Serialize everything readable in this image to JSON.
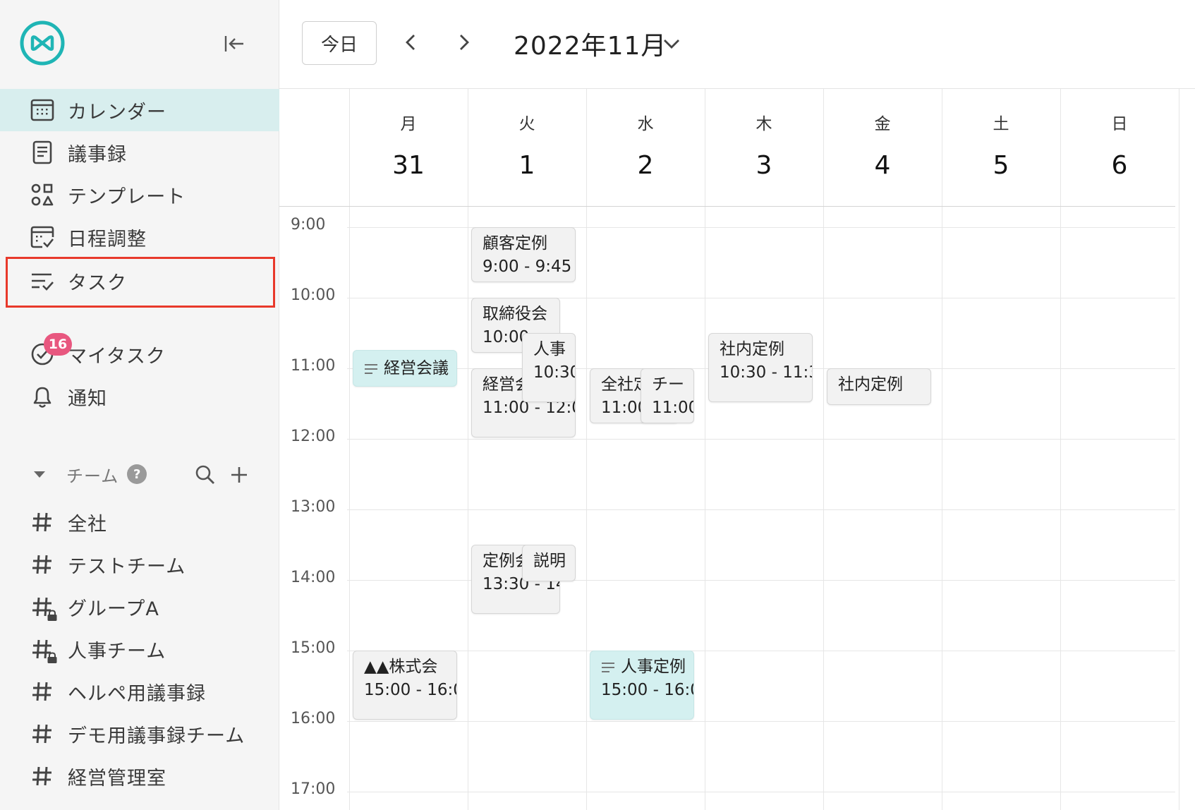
{
  "sidebar": {
    "nav": [
      {
        "label": "カレンダー",
        "icon": "calendar-icon",
        "active": true
      },
      {
        "label": "議事録",
        "icon": "document-icon"
      },
      {
        "label": "テンプレート",
        "icon": "template-icon"
      },
      {
        "label": "日程調整",
        "icon": "schedule-icon"
      },
      {
        "label": "タスク",
        "icon": "task-list-icon",
        "highlighted": true
      }
    ],
    "mytask": {
      "label": "マイタスク",
      "badge": "16"
    },
    "notify": {
      "label": "通知"
    },
    "team": {
      "label": "チーム",
      "help": "?",
      "items": [
        {
          "label": "全社",
          "locked": false
        },
        {
          "label": "テストチーム",
          "locked": false
        },
        {
          "label": "グループA",
          "locked": true
        },
        {
          "label": "人事チーム",
          "locked": true
        },
        {
          "label": "ヘルペ用議事録",
          "locked": false
        },
        {
          "label": "デモ用議事録チーム",
          "locked": false
        },
        {
          "label": "経営管理室",
          "locked": false
        }
      ]
    }
  },
  "header": {
    "today": "今日",
    "month": "2022年11月"
  },
  "calendar": {
    "days": [
      {
        "dow": "月",
        "num": "31"
      },
      {
        "dow": "火",
        "num": "1"
      },
      {
        "dow": "水",
        "num": "2"
      },
      {
        "dow": "木",
        "num": "3"
      },
      {
        "dow": "金",
        "num": "4"
      },
      {
        "dow": "土",
        "num": "5"
      },
      {
        "dow": "日",
        "num": "6"
      }
    ],
    "times": [
      "9:00",
      "10:00",
      "11:00",
      "12:00",
      "13:00",
      "14:00",
      "15:00",
      "16:00",
      "17:00"
    ],
    "events": [
      {
        "id": "e1",
        "title": "経営会議",
        "time": ""
      },
      {
        "id": "e2",
        "title": "▲▲株式会",
        "time": "15:00 - 16:0"
      },
      {
        "id": "e3",
        "title": "顧客定例",
        "time": "9:00 - 9:45"
      },
      {
        "id": "e4",
        "title": "取締役会",
        "time": "10:00"
      },
      {
        "id": "e5",
        "title": "経営会",
        "time": "11:00 - 12:0"
      },
      {
        "id": "e6",
        "title": "人事",
        "time": "10:30"
      },
      {
        "id": "e7",
        "title": "定例会",
        "time": "13:30 - 14"
      },
      {
        "id": "e8",
        "title": "説明",
        "time": ""
      },
      {
        "id": "e9",
        "title": "全社定",
        "time": "11:00"
      },
      {
        "id": "e10",
        "title": "チー",
        "time": "11:00"
      },
      {
        "id": "e11",
        "title": "人事定例",
        "time": "15:00 - 16:0"
      },
      {
        "id": "e12",
        "title": "社内定例",
        "time": "10:30 - 11:3"
      },
      {
        "id": "e13",
        "title": "社内定例",
        "time": ""
      }
    ]
  },
  "colors": {
    "accent": "#1fb5b5",
    "active_bg": "#d8eeee",
    "highlight_box": "#e8392b",
    "badge": "#e8577f",
    "event_teal": "#d4f0f0",
    "event_gray": "#f2f2f2"
  }
}
